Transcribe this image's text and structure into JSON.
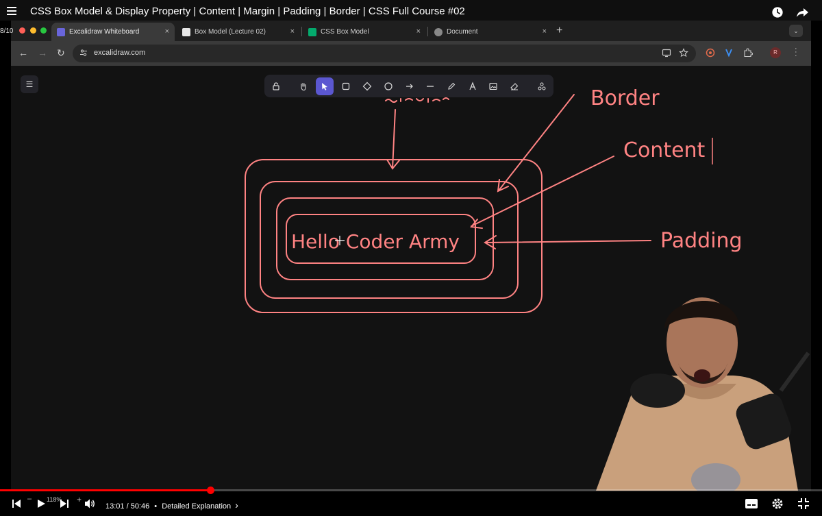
{
  "video": {
    "title": "CSS Box Model & Display Property | Content | Margin | Padding | Border | CSS Full Course #02",
    "time_display": "13:01 / 50:46",
    "separator": "•",
    "chapter": "Detailed Explanation",
    "chapter_arrow": "›",
    "speed_label": "118%",
    "speed_minus": "–",
    "speed_plus": "+",
    "progress_fraction": 0.256
  },
  "browser": {
    "tab_counter": "8/10",
    "tabs": [
      {
        "label": "Excalidraw Whiteboard",
        "active": true
      },
      {
        "label": "Box Model (Lecture 02)",
        "active": false
      },
      {
        "label": "CSS Box Model",
        "active": false
      },
      {
        "label": "Document",
        "active": false
      }
    ],
    "tab_close": "×",
    "new_tab": "+",
    "tab_menu": "⌄",
    "url": "excalidraw.com",
    "profile_initial": "R"
  },
  "excalidraw": {
    "menu_glyph": "☰",
    "tools": [
      "lock-icon",
      "hand-icon",
      "selection-icon",
      "rectangle-icon",
      "diamond-icon",
      "ellipse-icon",
      "arrow-icon",
      "line-icon",
      "pencil-icon",
      "text-icon",
      "image-icon",
      "eraser-icon",
      "extra-tools-icon"
    ],
    "selected_tool": "selection-icon",
    "labels": {
      "center_text": "Hello Coder Army",
      "border": "Border",
      "content": "Content",
      "padding": "Padding"
    },
    "stroke_color": "#ff8383",
    "canvas_color": "#121212"
  },
  "colors": {
    "progress": "#ff0000",
    "selected_tool": "#5b57d1"
  }
}
